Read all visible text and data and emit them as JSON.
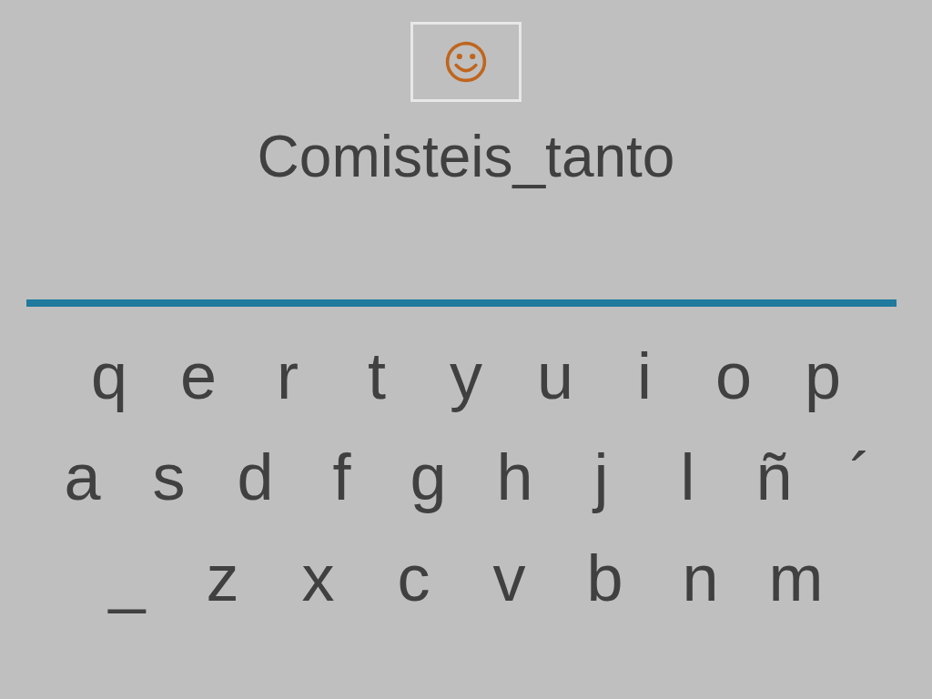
{
  "title": "Comisteis_tanto",
  "keyboard": {
    "rows": [
      [
        "q",
        "e",
        "r",
        "t",
        "y",
        "u",
        "i",
        "o",
        "p"
      ],
      [
        "a",
        "s",
        "d",
        "f",
        "g",
        "h",
        "j",
        "l",
        "ñ",
        "´"
      ],
      [
        "_",
        "z",
        "x",
        "c",
        "v",
        "b",
        "n",
        "m"
      ]
    ]
  }
}
